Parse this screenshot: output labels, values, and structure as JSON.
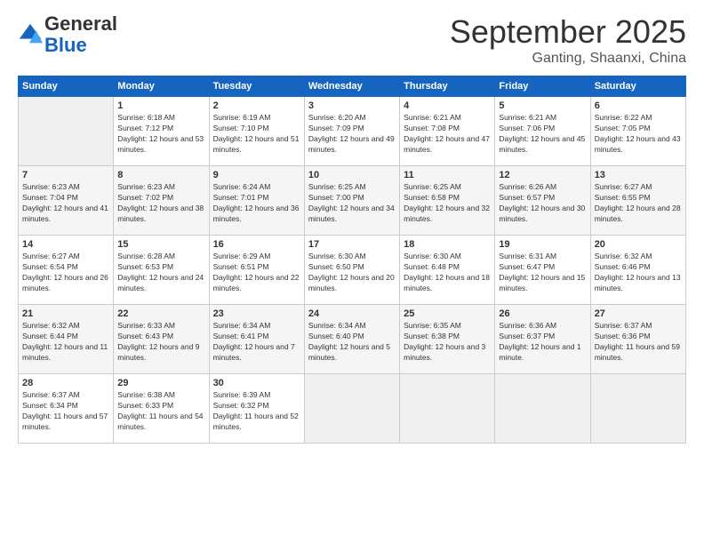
{
  "header": {
    "logo_general": "General",
    "logo_blue": "Blue",
    "month_title": "September 2025",
    "location": "Ganting, Shaanxi, China"
  },
  "weekdays": [
    "Sunday",
    "Monday",
    "Tuesday",
    "Wednesday",
    "Thursday",
    "Friday",
    "Saturday"
  ],
  "weeks": [
    [
      {
        "day": "",
        "sunrise": "",
        "sunset": "",
        "daylight": ""
      },
      {
        "day": "1",
        "sunrise": "Sunrise: 6:18 AM",
        "sunset": "Sunset: 7:12 PM",
        "daylight": "Daylight: 12 hours and 53 minutes."
      },
      {
        "day": "2",
        "sunrise": "Sunrise: 6:19 AM",
        "sunset": "Sunset: 7:10 PM",
        "daylight": "Daylight: 12 hours and 51 minutes."
      },
      {
        "day": "3",
        "sunrise": "Sunrise: 6:20 AM",
        "sunset": "Sunset: 7:09 PM",
        "daylight": "Daylight: 12 hours and 49 minutes."
      },
      {
        "day": "4",
        "sunrise": "Sunrise: 6:21 AM",
        "sunset": "Sunset: 7:08 PM",
        "daylight": "Daylight: 12 hours and 47 minutes."
      },
      {
        "day": "5",
        "sunrise": "Sunrise: 6:21 AM",
        "sunset": "Sunset: 7:06 PM",
        "daylight": "Daylight: 12 hours and 45 minutes."
      },
      {
        "day": "6",
        "sunrise": "Sunrise: 6:22 AM",
        "sunset": "Sunset: 7:05 PM",
        "daylight": "Daylight: 12 hours and 43 minutes."
      }
    ],
    [
      {
        "day": "7",
        "sunrise": "Sunrise: 6:23 AM",
        "sunset": "Sunset: 7:04 PM",
        "daylight": "Daylight: 12 hours and 41 minutes."
      },
      {
        "day": "8",
        "sunrise": "Sunrise: 6:23 AM",
        "sunset": "Sunset: 7:02 PM",
        "daylight": "Daylight: 12 hours and 38 minutes."
      },
      {
        "day": "9",
        "sunrise": "Sunrise: 6:24 AM",
        "sunset": "Sunset: 7:01 PM",
        "daylight": "Daylight: 12 hours and 36 minutes."
      },
      {
        "day": "10",
        "sunrise": "Sunrise: 6:25 AM",
        "sunset": "Sunset: 7:00 PM",
        "daylight": "Daylight: 12 hours and 34 minutes."
      },
      {
        "day": "11",
        "sunrise": "Sunrise: 6:25 AM",
        "sunset": "Sunset: 6:58 PM",
        "daylight": "Daylight: 12 hours and 32 minutes."
      },
      {
        "day": "12",
        "sunrise": "Sunrise: 6:26 AM",
        "sunset": "Sunset: 6:57 PM",
        "daylight": "Daylight: 12 hours and 30 minutes."
      },
      {
        "day": "13",
        "sunrise": "Sunrise: 6:27 AM",
        "sunset": "Sunset: 6:55 PM",
        "daylight": "Daylight: 12 hours and 28 minutes."
      }
    ],
    [
      {
        "day": "14",
        "sunrise": "Sunrise: 6:27 AM",
        "sunset": "Sunset: 6:54 PM",
        "daylight": "Daylight: 12 hours and 26 minutes."
      },
      {
        "day": "15",
        "sunrise": "Sunrise: 6:28 AM",
        "sunset": "Sunset: 6:53 PM",
        "daylight": "Daylight: 12 hours and 24 minutes."
      },
      {
        "day": "16",
        "sunrise": "Sunrise: 6:29 AM",
        "sunset": "Sunset: 6:51 PM",
        "daylight": "Daylight: 12 hours and 22 minutes."
      },
      {
        "day": "17",
        "sunrise": "Sunrise: 6:30 AM",
        "sunset": "Sunset: 6:50 PM",
        "daylight": "Daylight: 12 hours and 20 minutes."
      },
      {
        "day": "18",
        "sunrise": "Sunrise: 6:30 AM",
        "sunset": "Sunset: 6:48 PM",
        "daylight": "Daylight: 12 hours and 18 minutes."
      },
      {
        "day": "19",
        "sunrise": "Sunrise: 6:31 AM",
        "sunset": "Sunset: 6:47 PM",
        "daylight": "Daylight: 12 hours and 15 minutes."
      },
      {
        "day": "20",
        "sunrise": "Sunrise: 6:32 AM",
        "sunset": "Sunset: 6:46 PM",
        "daylight": "Daylight: 12 hours and 13 minutes."
      }
    ],
    [
      {
        "day": "21",
        "sunrise": "Sunrise: 6:32 AM",
        "sunset": "Sunset: 6:44 PM",
        "daylight": "Daylight: 12 hours and 11 minutes."
      },
      {
        "day": "22",
        "sunrise": "Sunrise: 6:33 AM",
        "sunset": "Sunset: 6:43 PM",
        "daylight": "Daylight: 12 hours and 9 minutes."
      },
      {
        "day": "23",
        "sunrise": "Sunrise: 6:34 AM",
        "sunset": "Sunset: 6:41 PM",
        "daylight": "Daylight: 12 hours and 7 minutes."
      },
      {
        "day": "24",
        "sunrise": "Sunrise: 6:34 AM",
        "sunset": "Sunset: 6:40 PM",
        "daylight": "Daylight: 12 hours and 5 minutes."
      },
      {
        "day": "25",
        "sunrise": "Sunrise: 6:35 AM",
        "sunset": "Sunset: 6:38 PM",
        "daylight": "Daylight: 12 hours and 3 minutes."
      },
      {
        "day": "26",
        "sunrise": "Sunrise: 6:36 AM",
        "sunset": "Sunset: 6:37 PM",
        "daylight": "Daylight: 12 hours and 1 minute."
      },
      {
        "day": "27",
        "sunrise": "Sunrise: 6:37 AM",
        "sunset": "Sunset: 6:36 PM",
        "daylight": "Daylight: 11 hours and 59 minutes."
      }
    ],
    [
      {
        "day": "28",
        "sunrise": "Sunrise: 6:37 AM",
        "sunset": "Sunset: 6:34 PM",
        "daylight": "Daylight: 11 hours and 57 minutes."
      },
      {
        "day": "29",
        "sunrise": "Sunrise: 6:38 AM",
        "sunset": "Sunset: 6:33 PM",
        "daylight": "Daylight: 11 hours and 54 minutes."
      },
      {
        "day": "30",
        "sunrise": "Sunrise: 6:39 AM",
        "sunset": "Sunset: 6:32 PM",
        "daylight": "Daylight: 11 hours and 52 minutes."
      },
      {
        "day": "",
        "sunrise": "",
        "sunset": "",
        "daylight": ""
      },
      {
        "day": "",
        "sunrise": "",
        "sunset": "",
        "daylight": ""
      },
      {
        "day": "",
        "sunrise": "",
        "sunset": "",
        "daylight": ""
      },
      {
        "day": "",
        "sunrise": "",
        "sunset": "",
        "daylight": ""
      }
    ]
  ]
}
